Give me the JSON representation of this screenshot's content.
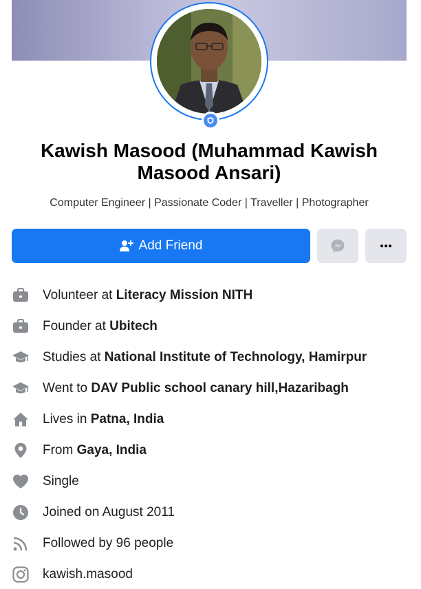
{
  "profile": {
    "name": "Kawish Masood (Muhammad Kawish Masood Ansari)",
    "bio": "Computer Engineer | Passionate Coder | Traveller | Photographer"
  },
  "actions": {
    "add_friend_label": "Add Friend"
  },
  "intro": [
    {
      "icon": "briefcase-icon",
      "prefix": "Volunteer at",
      "bold": "Literacy Mission NITH"
    },
    {
      "icon": "briefcase-icon",
      "prefix": "Founder at",
      "bold": "Ubitech"
    },
    {
      "icon": "graduation-cap-icon",
      "prefix": "Studies at",
      "bold": "National Institute of Technology, Hamirpur"
    },
    {
      "icon": "graduation-cap-icon",
      "prefix": "Went to",
      "bold": "DAV Public school canary hill,Hazaribagh"
    },
    {
      "icon": "home-icon",
      "prefix": "Lives in",
      "bold": "Patna, India"
    },
    {
      "icon": "location-pin-icon",
      "prefix": "From",
      "bold": "Gaya, India"
    },
    {
      "icon": "heart-icon",
      "prefix": "Single",
      "bold": ""
    },
    {
      "icon": "clock-icon",
      "prefix": "Joined on August 2011",
      "bold": ""
    },
    {
      "icon": "rss-icon",
      "prefix": "Followed by 96 people",
      "bold": ""
    },
    {
      "icon": "instagram-icon",
      "prefix": "kawish.masood",
      "bold": ""
    }
  ],
  "colors": {
    "primary": "#1877f2",
    "button_gray": "#e4e6eb",
    "icon_gray": "#65676b"
  }
}
